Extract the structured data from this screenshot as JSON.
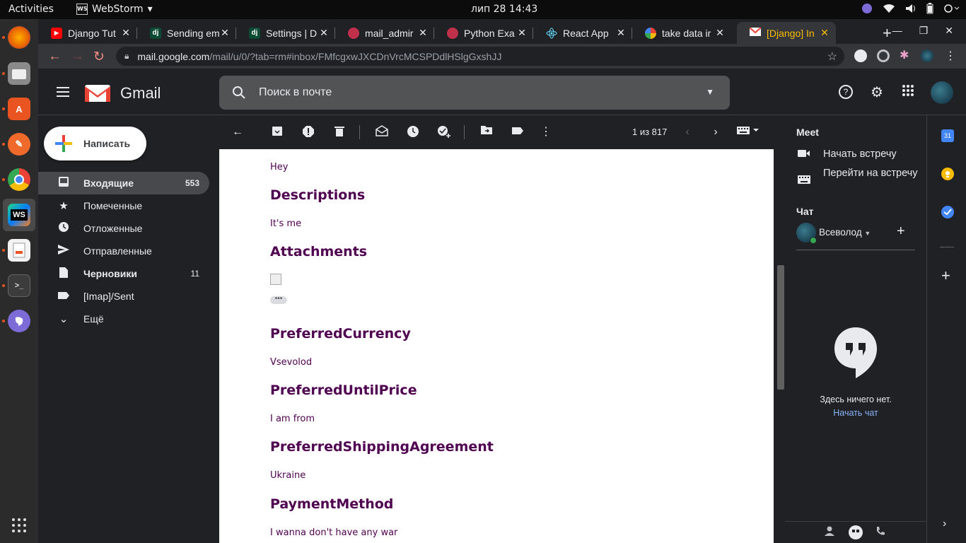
{
  "topbar": {
    "activities": "Activities",
    "app_name": "WebStorm",
    "app_dropdown": "▾",
    "clock": "лип 28  14:43"
  },
  "dock": {
    "items": [
      "firefox-icon",
      "files-icon",
      "software-icon",
      "pen-icon",
      "chrome-icon",
      "webstorm-icon",
      "document-viewer-icon",
      "terminal-icon",
      "viber-icon"
    ],
    "webstorm_label": "WS"
  },
  "browser": {
    "tabs": [
      {
        "title": "Django Tut",
        "icon": "youtube-icon",
        "color": "#ff0000"
      },
      {
        "title": "Sending em",
        "icon": "django-icon",
        "color": "#0c4b33"
      },
      {
        "title": "Settings | D",
        "icon": "django-icon",
        "color": "#0c4b33"
      },
      {
        "title": "mail_admir",
        "icon": "pypi-icon",
        "color": "#c0304b"
      },
      {
        "title": "Python Exa",
        "icon": "pypi-icon",
        "color": "#c0304b"
      },
      {
        "title": "React App",
        "icon": "react-icon",
        "color": "#61dafb"
      },
      {
        "title": "take data ir",
        "icon": "google-icon",
        "color": "#4285f4"
      },
      {
        "title": "[Django] In",
        "icon": "gmail-icon",
        "color": "#ea4335"
      }
    ],
    "django_badge": "dj",
    "close_glyph": "✕",
    "new_tab": "+",
    "address_host": "mail.google.com",
    "address_path": "/mail/u/0/?tab=rm#inbox/FMfcgxwJXCDnVrcMCSPDdlHSlgGxshJJ"
  },
  "gmail": {
    "brand": "Gmail",
    "search_placeholder": "Поиск в почте",
    "compose": "Написать",
    "nav": [
      {
        "label": "Входящие",
        "icon": "inbox-icon",
        "count": "553",
        "selected": true
      },
      {
        "label": "Помеченные",
        "icon": "star-icon",
        "count": ""
      },
      {
        "label": "Отложенные",
        "icon": "clock-icon",
        "count": ""
      },
      {
        "label": "Отправленные",
        "icon": "send-icon",
        "count": ""
      },
      {
        "label": "Черновики",
        "icon": "draft-icon",
        "count": "11"
      },
      {
        "label": "[Imap]/Sent",
        "icon": "label-icon",
        "count": ""
      },
      {
        "label": "Ещё",
        "icon": "chevron-down-icon",
        "count": ""
      }
    ],
    "pager": "1 из 817",
    "message": [
      {
        "kind": "text",
        "value": "Hey"
      },
      {
        "kind": "heading",
        "value": "Descriptions"
      },
      {
        "kind": "text",
        "value": "It's me"
      },
      {
        "kind": "heading",
        "value": "Attachments"
      },
      {
        "kind": "heading",
        "value": "PreferredCurrency"
      },
      {
        "kind": "text",
        "value": "Vsevolod"
      },
      {
        "kind": "heading",
        "value": "PreferredUntilPrice"
      },
      {
        "kind": "text",
        "value": "I am from"
      },
      {
        "kind": "heading",
        "value": "PreferredShippingAgreement"
      },
      {
        "kind": "text",
        "value": "Ukraine"
      },
      {
        "kind": "heading",
        "value": "PaymentMethod"
      },
      {
        "kind": "text",
        "value": "I wanna don't have any war"
      }
    ],
    "side": {
      "meet_title": "Meet",
      "start_meeting": "Начать встречу",
      "join_meeting": "Перейти на встречу",
      "chat_title": "Чат",
      "user": "Всеволод",
      "empty": "Здесь ничего нет.",
      "start_chat": "Начать чат"
    },
    "calendar_day": "31"
  },
  "colors": {
    "message_text": "#500050",
    "accent_link": "#8ab4f8",
    "online": "#34a853"
  }
}
